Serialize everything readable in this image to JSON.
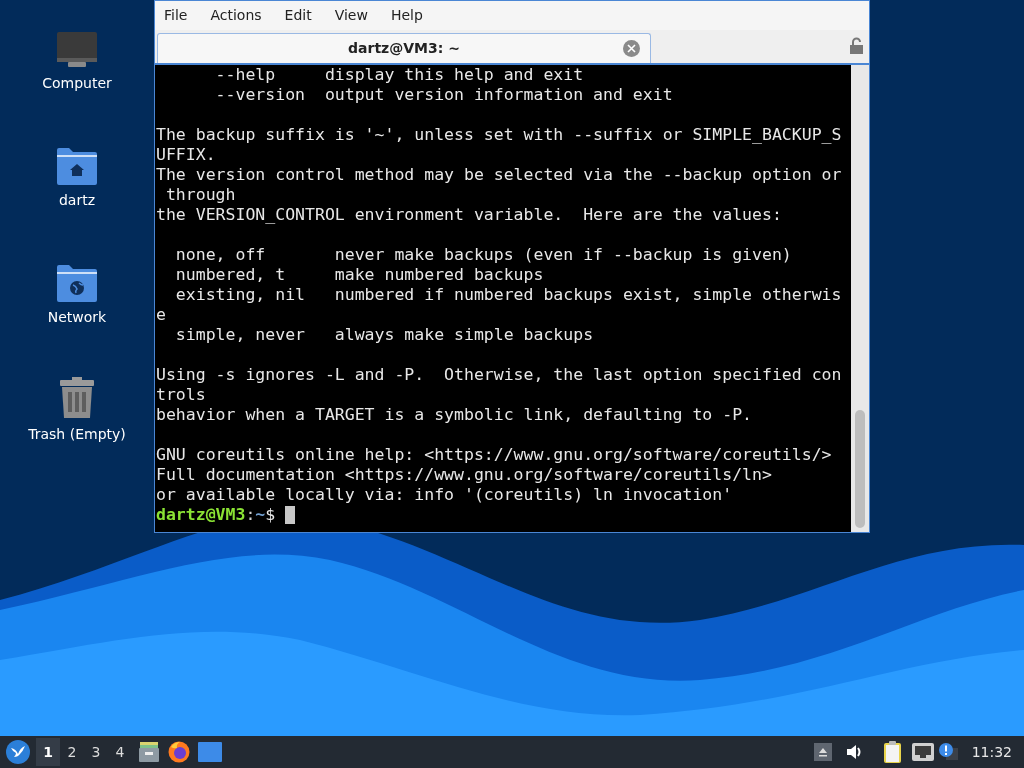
{
  "desktop_icons": [
    {
      "kind": "computer",
      "label": "Computer"
    },
    {
      "kind": "home",
      "label": "dartz"
    },
    {
      "kind": "network",
      "label": "Network"
    },
    {
      "kind": "trash",
      "label": "Trash (Empty)"
    }
  ],
  "terminal": {
    "menu": [
      "File",
      "Actions",
      "Edit",
      "View",
      "Help"
    ],
    "tabs": [
      {
        "title": "dartz@VM3: ~",
        "selected": true
      }
    ],
    "lines": [
      {
        "kind": "text",
        "text": "      --help     display this help and exit"
      },
      {
        "kind": "text",
        "text": "      --version  output version information and exit"
      },
      {
        "kind": "blank"
      },
      {
        "kind": "text",
        "text": "The backup suffix is '~', unless set with --suffix or SIMPLE_BACKUP_S"
      },
      {
        "kind": "text",
        "text": "UFFIX."
      },
      {
        "kind": "text",
        "text": "The version control method may be selected via the --backup option or"
      },
      {
        "kind": "text",
        "text": " through"
      },
      {
        "kind": "text",
        "text": "the VERSION_CONTROL environment variable.  Here are the values:"
      },
      {
        "kind": "blank"
      },
      {
        "kind": "text",
        "text": "  none, off       never make backups (even if --backup is given)"
      },
      {
        "kind": "text",
        "text": "  numbered, t     make numbered backups"
      },
      {
        "kind": "text",
        "text": "  existing, nil   numbered if numbered backups exist, simple otherwis"
      },
      {
        "kind": "text",
        "text": "e"
      },
      {
        "kind": "text",
        "text": "  simple, never   always make simple backups"
      },
      {
        "kind": "blank"
      },
      {
        "kind": "text",
        "text": "Using -s ignores -L and -P.  Otherwise, the last option specified con"
      },
      {
        "kind": "text",
        "text": "trols"
      },
      {
        "kind": "text",
        "text": "behavior when a TARGET is a symbolic link, defaulting to -P."
      },
      {
        "kind": "blank"
      },
      {
        "kind": "text",
        "text": "GNU coreutils online help: <https://www.gnu.org/software/coreutils/>"
      },
      {
        "kind": "text",
        "text": "Full documentation <https://www.gnu.org/software/coreutils/ln>"
      },
      {
        "kind": "text",
        "text": "or available locally via: info '(coreutils) ln invocation'"
      }
    ],
    "prompt": {
      "user_host": "dartz@VM3",
      "separator": ":",
      "path": "~",
      "symbol": "$"
    }
  },
  "taskbar": {
    "workspaces": [
      {
        "label": "1",
        "selected": true
      },
      {
        "label": "2",
        "selected": false
      },
      {
        "label": "3",
        "selected": false
      },
      {
        "label": "4",
        "selected": false
      }
    ],
    "clock": "11:32"
  }
}
